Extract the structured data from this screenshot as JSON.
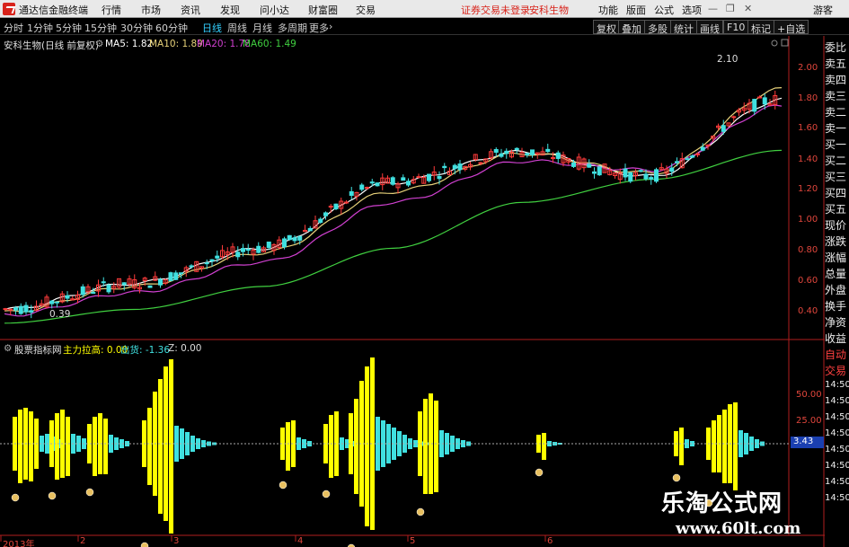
{
  "menu": {
    "app_title": "通达信金融终端",
    "items": [
      "行情",
      "市场",
      "资讯",
      "发现",
      "问小达",
      "财富圈",
      "交易"
    ],
    "notice": "证券交易未登录",
    "stock": "安科生物",
    "right_items": [
      "功能",
      "版面",
      "公式",
      "选项"
    ],
    "guest": "游客"
  },
  "toolbar": {
    "periods": [
      "分时",
      "1分钟",
      "5分钟",
      "15分钟",
      "30分钟",
      "60分钟",
      "日线",
      "周线",
      "月线",
      "多周期",
      "更多"
    ],
    "active_period": "日线",
    "right_buttons": [
      "复权",
      "叠加",
      "多股",
      "统计",
      "画线",
      "F10",
      "标记",
      "+自选"
    ]
  },
  "main_chart": {
    "title": "安科生物(日线 前复权)",
    "ma_legend": [
      {
        "label": "MA5: 1.82",
        "color": "#ffffff"
      },
      {
        "label": "MA10: 1.89",
        "color": "#e8d27a"
      },
      {
        "label": "MA20: 1.78",
        "color": "#d040d0"
      },
      {
        "label": "MA60: 1.49",
        "color": "#40d040"
      }
    ],
    "price_ticks": [
      "2.00",
      "1.80",
      "1.60",
      "1.40",
      "1.20",
      "1.00",
      "0.80",
      "0.60",
      "0.40"
    ],
    "high_label": "2.10",
    "low_label": "0.39"
  },
  "sub_chart": {
    "title": "股票指标网",
    "legend": [
      {
        "label": "主力拉高: 0.00",
        "color": "#ffff00"
      },
      {
        "label": "出货: -1.36",
        "color": "#40e0e0"
      },
      {
        "label": "Z: 0.00",
        "color": "#dddddd"
      }
    ],
    "ticks": [
      "50.00",
      "25.00"
    ],
    "current_value": "3.43"
  },
  "x_axis": [
    "2013年",
    "2",
    "3",
    "4",
    "5",
    "6"
  ],
  "side_panel": [
    "委比",
    "卖五",
    "卖四",
    "卖三",
    "卖二",
    "卖一",
    "买一",
    "买二",
    "买三",
    "买四",
    "买五",
    "现价",
    "涨跌",
    "涨幅",
    "总量",
    "外盘",
    "换手",
    "净资",
    "收益",
    "自动",
    "交易"
  ],
  "side_panel_times": [
    "14:50",
    "14:50",
    "14:50",
    "14:50",
    "14:50",
    "14:50",
    "14:50",
    "14:50"
  ],
  "watermark": {
    "cn": "乐淘公式网",
    "url": "www.60lt.com"
  },
  "colors": {
    "up": "#ff3b3b",
    "down": "#40e0e0",
    "axis": "#b01e1e",
    "yellow": "#ffff00"
  },
  "chart_data": {
    "type": "line",
    "title": "安科生物(日线 前复权)",
    "xlabel": "",
    "ylabel": "",
    "x": [
      "2013年",
      "2",
      "3",
      "4",
      "5",
      "6"
    ],
    "ylim": [
      0.3,
      2.15
    ],
    "series": [
      {
        "name": "MA5",
        "values": [
          0.45,
          0.62,
          0.85,
          1.28,
          1.48,
          1.32,
          1.82
        ]
      },
      {
        "name": "MA10",
        "values": [
          0.43,
          0.6,
          0.82,
          1.22,
          1.47,
          1.34,
          1.89
        ]
      },
      {
        "name": "MA20",
        "values": [
          0.41,
          0.56,
          0.76,
          1.15,
          1.42,
          1.36,
          1.78
        ]
      },
      {
        "name": "MA60",
        "values": [
          0.36,
          0.45,
          0.6,
          0.85,
          1.15,
          1.3,
          1.49
        ]
      }
    ]
  }
}
